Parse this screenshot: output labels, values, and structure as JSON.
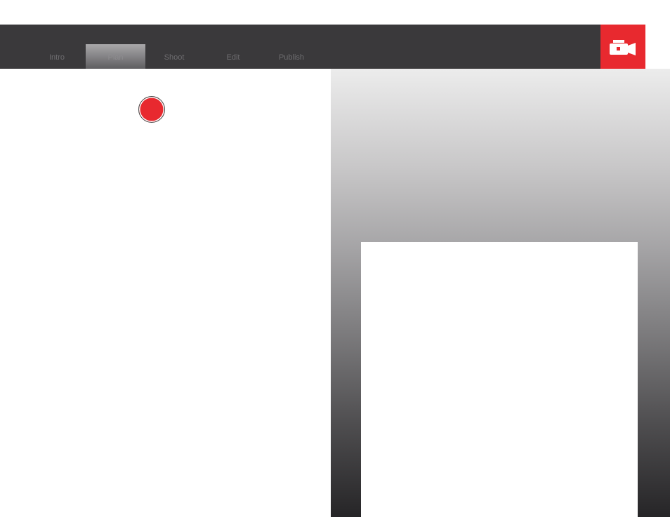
{
  "nav": {
    "tabs": [
      {
        "label": "Intro"
      },
      {
        "label": "Plan"
      },
      {
        "label": "Shoot"
      },
      {
        "label": "Edit"
      },
      {
        "label": "Publish"
      }
    ],
    "active_tab": "Plan",
    "icon": "video-camera-icon"
  },
  "record": {
    "icon": "record-dot-icon"
  },
  "colors": {
    "navbar_bg": "#3a393b",
    "accent_red": "#e8292f",
    "tab_text": "#6d6c6f"
  }
}
